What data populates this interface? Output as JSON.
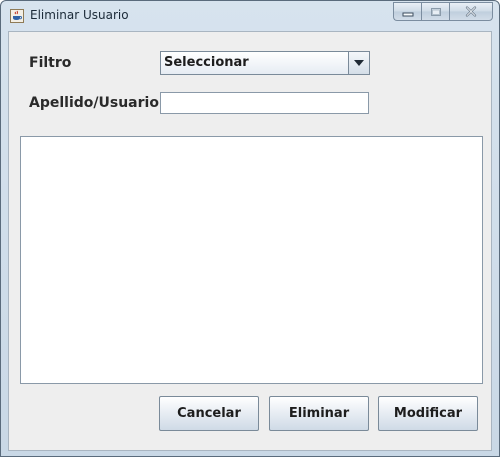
{
  "window": {
    "title": "Eliminar Usuario",
    "app_icon": "java-cup-icon",
    "controls": [
      "minimize-icon",
      "maximize-icon",
      "close-icon"
    ]
  },
  "form": {
    "filtro_label": "Filtro",
    "filtro_value": "Seleccionar",
    "apellido_label": "Apellido/Usuario",
    "apellido_value": ""
  },
  "buttons": {
    "cancelar": "Cancelar",
    "eliminar": "Eliminar",
    "modificar": "Modificar"
  },
  "colors": {
    "panel_bg": "#eeeeee",
    "titlebar": "#c9d8e6",
    "close_icon": "#8a2a2a"
  }
}
